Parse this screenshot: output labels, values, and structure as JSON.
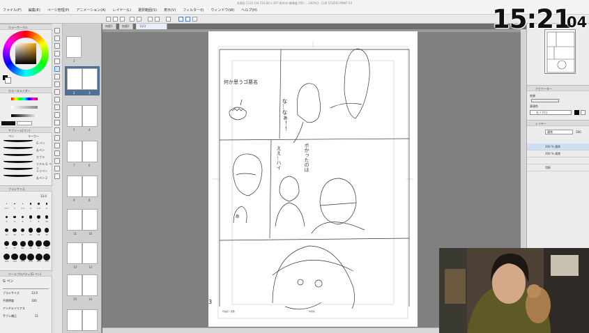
{
  "window": {
    "title": "未保存 [1/23 (A4 210.00 x 297.00mm 解像度 350 ... 100%)] - CLIP STUDIO PAINT EX"
  },
  "menu": [
    "ファイル(F)",
    "編集(E)",
    "ページ管理(P)",
    "アニメーション(A)",
    "レイヤー(L)",
    "選択範囲(S)",
    "表示(V)",
    "フィルター(I)",
    "ウィンドウ(W)",
    "ヘルプ(H)"
  ],
  "doc_tabs": [
    "無題1",
    "無題2",
    "無題3",
    "無題4",
    "1/23"
  ],
  "left": {
    "color_panel": "カラーサークル",
    "color_slider_panel": "カラースライダー",
    "sub_tool_panel": "サブツール[ペン]",
    "sub_tool_tabs": [
      "ペン",
      "マーカー"
    ],
    "brushes": [
      "G ペン",
      "丸ペン",
      "カブラ",
      "リアル G ペン",
      "ミリペン",
      "丸ペン 2"
    ],
    "brush_size_panel": "ブラシサイズ",
    "brush_size_value": "13.0",
    "brush_sizes": [
      "0.7",
      "1",
      "1.5",
      "2",
      "2.5",
      "3",
      "4",
      "5",
      "6",
      "7",
      "8",
      "10",
      "12",
      "15",
      "17",
      "20",
      "25",
      "30",
      "40",
      "50",
      "60",
      "70",
      "80",
      "100",
      "120",
      "150",
      "170",
      "200",
      "250",
      "300"
    ],
    "tool_property_panel": "ツールプロパティ[G ペン]",
    "tool_property_title": "G ペン",
    "props": [
      {
        "label": "ブラシサイズ",
        "value": "13.0"
      },
      {
        "label": "不透明度",
        "value": "100"
      },
      {
        "label": "アンチエイリアス",
        "value": ""
      },
      {
        "label": "手ブレ補正",
        "value": "11"
      }
    ]
  },
  "pages": {
    "items": [
      {
        "label": "1"
      },
      {
        "label": "2",
        "label2": "3"
      },
      {
        "label": "4",
        "label2": "5"
      },
      {
        "label": "6",
        "label2": "7"
      },
      {
        "label": "8",
        "label2": "9"
      },
      {
        "label": "10",
        "label2": "11"
      },
      {
        "label": "12",
        "label2": "13"
      },
      {
        "label": "14",
        "label2": "15"
      }
    ]
  },
  "canvas": {
    "page_number": "3",
    "footer_left": "作品名 / 話数",
    "footer_right": "作者名",
    "sketch_texts": [
      "何か思うゴ悪名",
      "な…なぁ！！",
      "ええ…ハイ",
      "ボかったのは",
      "ぁ"
    ]
  },
  "right": {
    "navigator_panel": "ナビゲーター",
    "layer_property_panel": "レイヤープロパティ",
    "effect_label": "効果",
    "expression_color_label": "表現色",
    "expression_color_value": "モノクロ",
    "layer_panel": "レイヤー",
    "blend_mode": "通常",
    "opacity": "100",
    "layers": [
      {
        "name": "100 % 通常",
        "sub": "レイヤー 1 のコピー 2",
        "selected": true
      },
      {
        "name": "100 % 通常",
        "sub": "レイヤー 1",
        "selected": false
      },
      {
        "name": "",
        "sub": "",
        "selected": false
      },
      {
        "name": "用紙",
        "sub": "",
        "selected": false
      }
    ]
  },
  "clock": {
    "hours_minutes": "15:21",
    "seconds": "04"
  },
  "colors": {
    "main_color": "#000000",
    "sub_color": "#ffffff",
    "selection_blue": "#4f6f95"
  }
}
